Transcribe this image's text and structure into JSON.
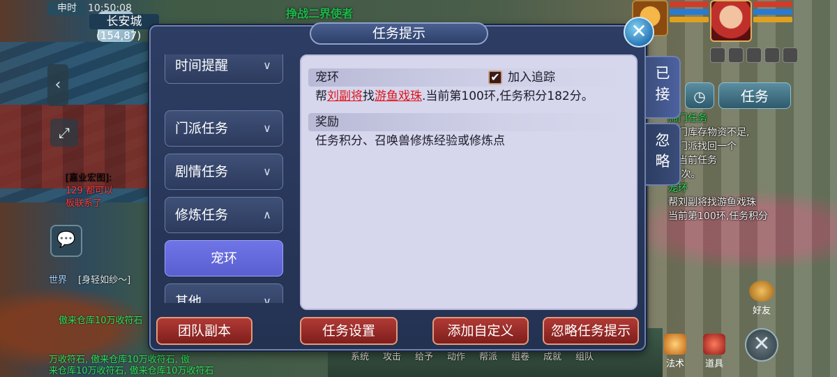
{
  "hud": {
    "time_label": "申时",
    "time": "10:50:08",
    "city": "长安城",
    "coords": "(154,87)",
    "top_title": "挣战二界使者"
  },
  "dialog": {
    "title": "任务提示",
    "categories": [
      {
        "label": "时间提醒",
        "expanded": false
      },
      {
        "label": "门派任务",
        "expanded": false
      },
      {
        "label": "剧情任务",
        "expanded": false
      },
      {
        "label": "修炼任务",
        "expanded": true
      },
      {
        "label": "宠环",
        "selected": true
      },
      {
        "label": "其他",
        "expanded": false
      }
    ],
    "task": {
      "name": "宠环",
      "track_label": "加入追踪",
      "track_checked": true,
      "desc_prefix": "帮",
      "npc": "刘副将",
      "desc_mid": "找",
      "item": "游鱼戏珠",
      "desc_suffix": ".当前第100环,任务积分182分。",
      "reward_head": "奖励",
      "reward_text": "任务积分、召唤兽修炼经验或修炼点"
    },
    "buttons": {
      "team_dungeon": "团队副本",
      "task_settings": "任务设置",
      "add_custom": "添加自定义",
      "ignore_tips": "忽略任务提示"
    },
    "side_tabs": {
      "accepted": "已接",
      "ignored": "忽略"
    }
  },
  "right_hud": {
    "task_button": "任务",
    "track_lines": [
      {
        "text": "师门任务",
        "color": "green"
      },
      {
        "text": "师门库存物资不足,",
        "color": "white"
      },
      {
        "text": "帮门派找回一个",
        "color": "white"
      },
      {
        "text": "。当前任务",
        "color": "white"
      },
      {
        "text": "第 次。",
        "color": "white"
      },
      {
        "text": "宠环",
        "color": "green"
      },
      {
        "text": "帮刘副将找游鱼戏珠",
        "color": "white"
      },
      {
        "text": "当前第100环,任务积分",
        "color": "white"
      }
    ],
    "friends": "好友",
    "magic": "法术",
    "items": "道具",
    "bottom_menu": [
      "系统",
      "攻击",
      "给予",
      "动作",
      "帮派",
      "组卷",
      "成就",
      "组队"
    ]
  },
  "chat": {
    "lines": [
      {
        "text": "[嘉业宏图]:",
        "color": "#dfe8e8"
      },
      {
        "text": "129 都可以",
        "color": "#ff3a3a"
      },
      {
        "text": "板联系了",
        "color": "#ff3a3a"
      },
      {
        "text": "世界",
        "color": "#9fd0ff"
      },
      {
        "text": "[身轻如纱〜]",
        "color": "#dfe8e8"
      },
      {
        "text": "傲来仓库10万收符石",
        "color": "#2fe05a"
      },
      {
        "text": "万收符石, 傲来仓库10万收符石, 傲",
        "color": "#2fe05a"
      },
      {
        "text": "来仓库10万收符石, 傲来仓库10万收符石",
        "color": "#2fe05a"
      }
    ]
  },
  "colors": {
    "accent_red": "#e0141a",
    "button_red": "#b13a35",
    "selected_purple": "#6f74e6",
    "panel_bg": "#d6d6ec"
  }
}
